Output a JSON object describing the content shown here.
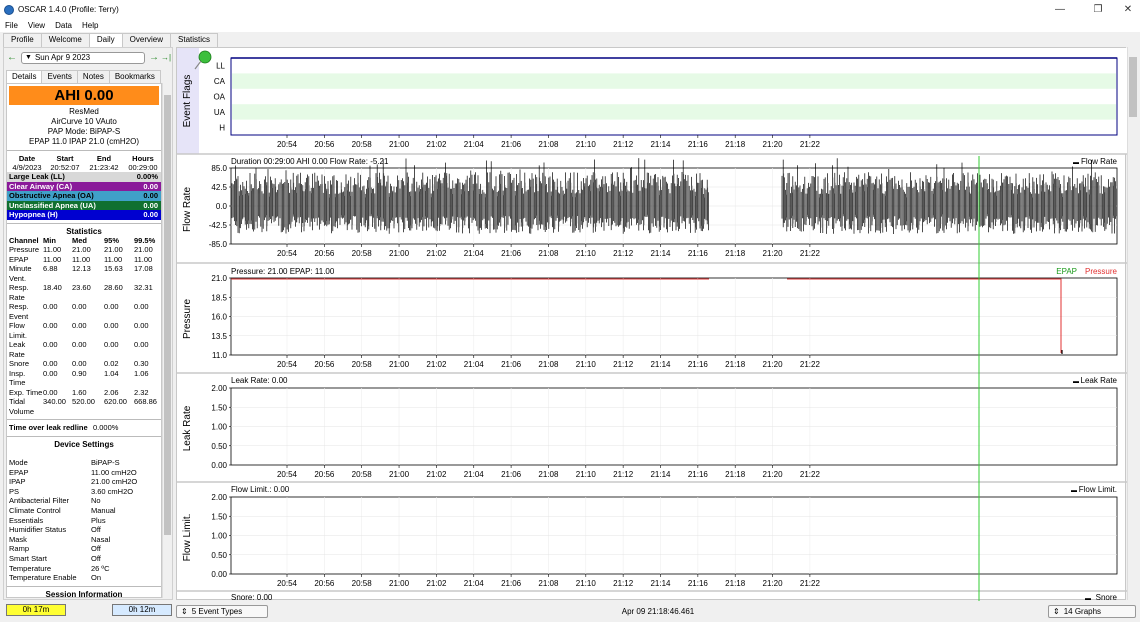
{
  "window": {
    "title": "OSCAR 1.4.0 (Profile: Terry)",
    "min": "—",
    "restore": "❐",
    "close": "✕"
  },
  "menu": [
    "File",
    "View",
    "Data",
    "Help"
  ],
  "top_tabs": [
    "Profile",
    "Welcome",
    "Daily",
    "Overview",
    "Statistics"
  ],
  "date_nav": {
    "back": "←",
    "date": "Sun Apr 9 2023",
    "forward": "→",
    "last": "→|"
  },
  "sub_tabs": [
    "Details",
    "Events",
    "Notes",
    "Bookmarks"
  ],
  "summary": {
    "ahi": "AHI 0.00",
    "brand": "ResMed",
    "model": "AirCurve 10 VAuto",
    "pap_mode": "PAP Mode: BiPAP-S",
    "pressures": "EPAP 11.0 IPAP 21.0 (cmH2O)",
    "session_headers": [
      "Date",
      "Start",
      "End",
      "Hours"
    ],
    "session_values": [
      "4/9/2023",
      "20:52:07",
      "21:23:42",
      "00:29:00"
    ]
  },
  "events": [
    {
      "label": "Large Leak (LL)",
      "value": "0.00%",
      "bg": "#d8d8d8",
      "fg": "#000000"
    },
    {
      "label": "Clear Airway (CA)",
      "value": "0.00",
      "bg": "#8a1a9a",
      "fg": "#ffffff"
    },
    {
      "label": "Obstructive Apnea (OA)",
      "value": "0.00",
      "bg": "#40a0c8",
      "fg": "#000000"
    },
    {
      "label": "Unclassified Apnea (UA)",
      "value": "0.00",
      "bg": "#107030",
      "fg": "#ffffff"
    },
    {
      "label": "Hypopnea (H)",
      "value": "0.00",
      "bg": "#0000d0",
      "fg": "#ffffff"
    }
  ],
  "statistics": {
    "title": "Statistics",
    "headers": [
      "Channel",
      "Min",
      "Med",
      "95%",
      "99.5%"
    ],
    "rows": [
      [
        "Pressure",
        "11.00",
        "21.00",
        "21.00",
        "21.00"
      ],
      [
        "EPAP",
        "11.00",
        "11.00",
        "11.00",
        "11.00"
      ],
      [
        "Minute Vent.",
        "6.88",
        "12.13",
        "15.63",
        "17.08"
      ],
      [
        "Resp. Rate",
        "18.40",
        "23.60",
        "28.60",
        "32.31"
      ],
      [
        "Resp. Event",
        "0.00",
        "0.00",
        "0.00",
        "0.00"
      ],
      [
        "Flow Limit.",
        "0.00",
        "0.00",
        "0.00",
        "0.00"
      ],
      [
        "Leak Rate",
        "0.00",
        "0.00",
        "0.00",
        "0.00"
      ],
      [
        "Snore",
        "0.00",
        "0.00",
        "0.02",
        "0.30"
      ],
      [
        "Insp. Time",
        "0.00",
        "0.90",
        "1.04",
        "1.06"
      ],
      [
        "Exp. Time",
        "0.00",
        "1.60",
        "2.06",
        "2.32"
      ],
      [
        "Tidal Volume",
        "340.00",
        "520.00",
        "620.00",
        "668.86"
      ]
    ],
    "leak_redline_label": "Time over leak redline",
    "leak_redline_value": "0.000%"
  },
  "device_settings": {
    "title": "Device Settings",
    "rows": [
      [
        "Mode",
        "BiPAP-S"
      ],
      [
        "EPAP",
        "11.00 cmH2O"
      ],
      [
        "IPAP",
        "21.00 cmH2O"
      ],
      [
        "PS",
        "3.60 cmH2O"
      ],
      [
        "Antibacterial Filter",
        "No"
      ],
      [
        "Climate Control",
        "Manual"
      ],
      [
        "Essentials",
        "Plus"
      ],
      [
        "Humidifier Status",
        "Off"
      ],
      [
        "Mask",
        "Nasal"
      ],
      [
        "Ramp",
        "Off"
      ],
      [
        "Smart Start",
        "Off"
      ],
      [
        "Temperature",
        "26 ºC"
      ],
      [
        "Temperature Enable",
        "On"
      ]
    ],
    "session_info": "Session Information"
  },
  "bottom_buttons": {
    "left": "0h 17m",
    "right": "0h 12m"
  },
  "time_ticks": [
    "20:54",
    "20:56",
    "20:58",
    "21:00",
    "21:02",
    "21:04",
    "21:06",
    "21:08",
    "21:10",
    "21:12",
    "21:14",
    "21:16",
    "21:18",
    "21:20",
    "21:22"
  ],
  "graphs": {
    "event_flags": {
      "label": "Event Flags",
      "rows": [
        "LL",
        "CA",
        "OA",
        "UA",
        "H"
      ]
    },
    "flow_rate": {
      "label": "Flow Rate",
      "title": "Duration 00:29:00 AHI 0.00 Flow Rate: -5.21",
      "legend": "Flow Rate",
      "yticks": [
        "85.0",
        "42.5",
        "0.0",
        "-42.5",
        "-85.0"
      ]
    },
    "pressure": {
      "label": "Pressure",
      "title": "Pressure: 21.00 EPAP: 11.00",
      "legend_a": "EPAP",
      "legend_b": "Pressure",
      "yticks": [
        "21.0",
        "18.5",
        "16.0",
        "13.5",
        "11.0"
      ]
    },
    "leak_rate": {
      "label": "Leak Rate",
      "title": "Leak Rate: 0.00",
      "legend": "Leak Rate",
      "yticks": [
        "2.00",
        "1.50",
        "1.00",
        "0.50",
        "0.00"
      ]
    },
    "flow_limit": {
      "label": "Flow Limit.",
      "title": "Flow Limit.: 0.00",
      "legend": "Flow Limit.",
      "yticks": [
        "2.00",
        "1.50",
        "1.00",
        "0.50",
        "0.00"
      ]
    },
    "snore": {
      "title": "Snore: 0.00",
      "legend": "Snore"
    }
  },
  "status": {
    "event_types": "5 Event Types",
    "cursor_time": "Apr 09 21:18:46.461",
    "graphs_count": "14 Graphs"
  },
  "colors": {
    "ahi_bg": "#ff8c1a",
    "marker": "#33cc33",
    "epap": "#1a9a1a",
    "pressure": "#e03030",
    "flag_band": "#e6fae6",
    "flag_border": "#000080"
  }
}
